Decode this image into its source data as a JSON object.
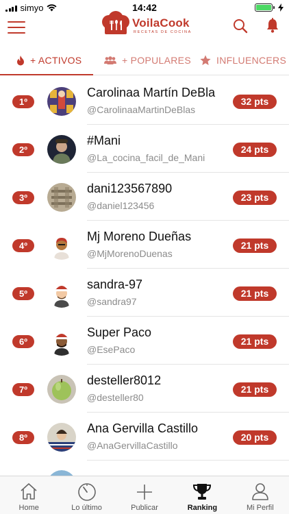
{
  "status_bar": {
    "carrier": "simyo",
    "time": "14:42",
    "battery_color": "#4cd964"
  },
  "header": {
    "logo_title": "VoilaCook",
    "logo_subtitle": "RECETAS DE COCINA",
    "icons": [
      "menu-icon",
      "search-icon",
      "bell-icon"
    ],
    "accent_color": "#c0392b"
  },
  "tabs": [
    {
      "label": "+ ACTIVOS",
      "icon": "flame-icon",
      "active": true
    },
    {
      "label": "+ POPULARES",
      "icon": "group-icon",
      "active": false
    },
    {
      "label": "INFLUENCERS",
      "icon": "star-icon",
      "active": false
    }
  ],
  "ranking": [
    {
      "rank": "1º",
      "name": "Carolinaa Martín DeBla",
      "handle": "@CarolinaaMartinDeBlas",
      "points": "32 pts"
    },
    {
      "rank": "2º",
      "name": "#Mani",
      "handle": "@La_cocina_facil_de_Mani",
      "points": "24 pts"
    },
    {
      "rank": "3º",
      "name": "dani123567890",
      "handle": "@daniel123456",
      "points": "23 pts"
    },
    {
      "rank": "4º",
      "name": "Mj Moreno Dueñas",
      "handle": "@MjMorenoDuenas",
      "points": "21 pts"
    },
    {
      "rank": "5º",
      "name": "sandra-97",
      "handle": "@sandra97",
      "points": "21 pts"
    },
    {
      "rank": "6º",
      "name": "Super Paco",
      "handle": "@EsePaco",
      "points": "21 pts"
    },
    {
      "rank": "7º",
      "name": "desteller8012",
      "handle": "@desteller80",
      "points": "21 pts"
    },
    {
      "rank": "8º",
      "name": "Ana Gervilla Castillo",
      "handle": "@AnaGervillaCastillo",
      "points": "20 pts"
    }
  ],
  "bottom_nav": [
    {
      "label": "Home",
      "icon": "home-icon",
      "active": false
    },
    {
      "label": "Lo último",
      "icon": "clock-icon",
      "active": false
    },
    {
      "label": "Publicar",
      "icon": "plus-icon",
      "active": false
    },
    {
      "label": "Ranking",
      "icon": "trophy-icon",
      "active": true
    },
    {
      "label": "Mi Perfil",
      "icon": "user-icon",
      "active": false
    }
  ]
}
